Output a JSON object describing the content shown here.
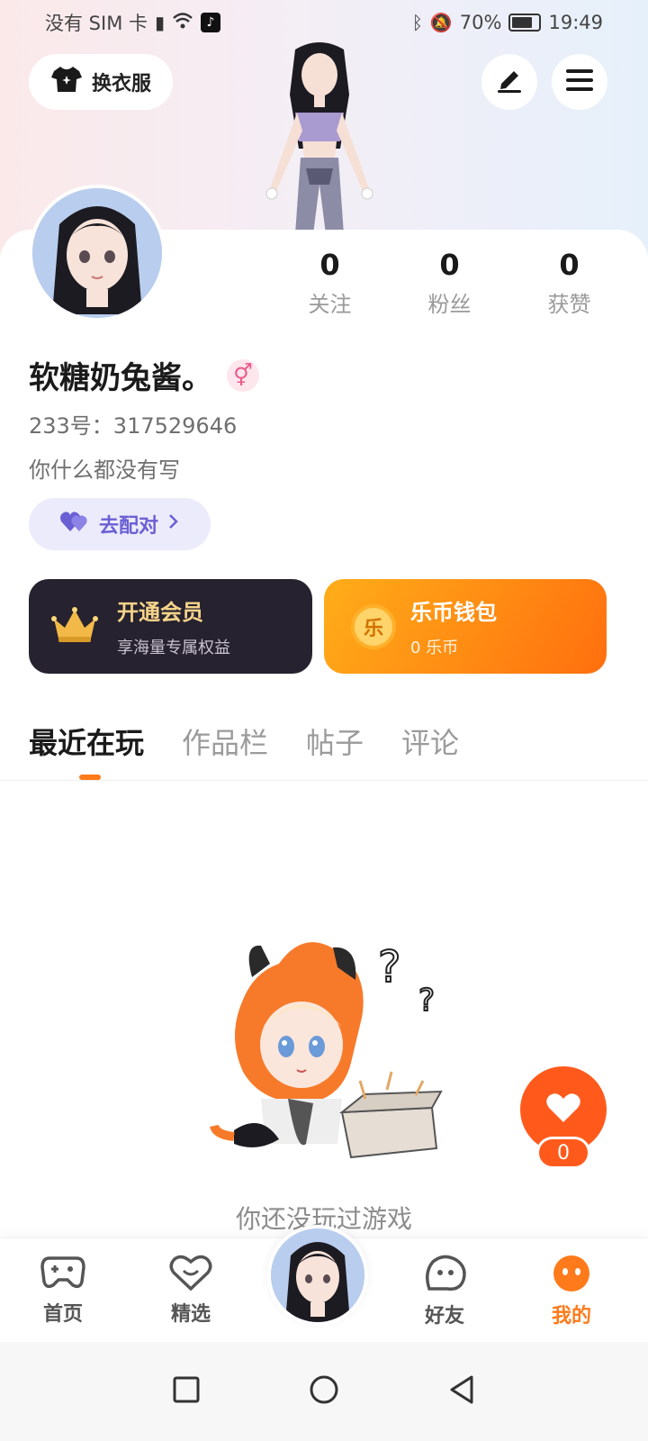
{
  "status_bar": {
    "carrier": "没有 SIM 卡",
    "battery": "70%",
    "time": "19:49"
  },
  "header": {
    "outfit_label": "换衣服"
  },
  "profile": {
    "stats": [
      {
        "value": "0",
        "label": "关注"
      },
      {
        "value": "0",
        "label": "粉丝"
      },
      {
        "value": "0",
        "label": "获赞"
      }
    ],
    "username": "软糖奶兔酱。",
    "gender_symbol": "⚥",
    "uid": "233号：317529646",
    "bio": "你什么都没有写",
    "pair_label": "去配对"
  },
  "cards": {
    "vip_title": "开通会员",
    "vip_sub": "享海量专属权益",
    "wallet_title": "乐币钱包",
    "wallet_sub": "0 乐币",
    "coin_char": "乐"
  },
  "tabs": [
    "最近在玩",
    "作品栏",
    "帖子",
    "评论"
  ],
  "empty_state": {
    "text": "你还没玩过游戏"
  },
  "like": {
    "count": "0"
  },
  "bottom_nav": [
    {
      "label": "首页",
      "icon": "gamepad-icon"
    },
    {
      "label": "精选",
      "icon": "heart-chat-icon"
    },
    {
      "label": "好友",
      "icon": "friend-face-icon"
    },
    {
      "label": "我的",
      "icon": "me-icon"
    }
  ],
  "colors": {
    "accent": "#ff7a1a",
    "like": "#ff5a1c",
    "vip_bg": "#26222f",
    "pair_text": "#6b5fd4"
  }
}
